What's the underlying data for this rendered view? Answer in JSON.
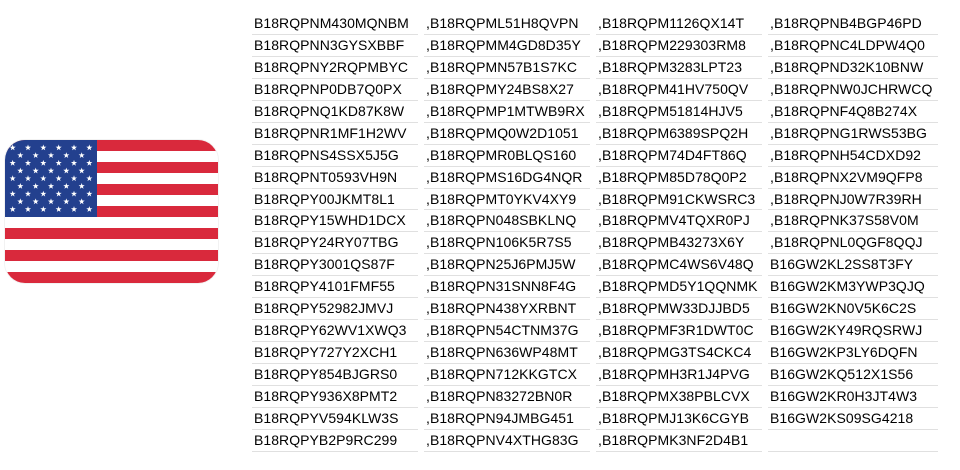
{
  "flag": {
    "name": "United States flag",
    "colors": {
      "red": "#d9293c",
      "white": "#ffffff",
      "blue": "#23408e",
      "stars": "#ffffff"
    }
  },
  "columns": [
    [
      "B18RQPNM430MQNBM",
      "B18RQPNN3GYSXBBF",
      "B18RQPNY2RQPMBYC",
      "B18RQPNP0DB7Q0PX",
      "B18RQPNQ1KD87K8W",
      "B18RQPNR1MF1H2WV",
      "B18RQPNS4SSX5J5G",
      "B18RQPNT0593VH9N",
      "B18RQPY00JKMT8L1",
      "B18RQPY15WHD1DCX",
      "B18RQPY24RY07TBG",
      "B18RQPY3001QS87F",
      "B18RQPY4101FMF55",
      "B18RQPY52982JMVJ",
      "B18RQPY62WV1XWQ3",
      "B18RQPY727Y2XCH1",
      "B18RQPY854BJGRS0",
      "B18RQPY936X8PMT2",
      "B18RQPYV594KLW3S",
      "B18RQPYB2P9RC299"
    ],
    [
      ",B18RQPML51H8QVPN",
      ",B18RQPMM4GD8D35Y",
      ",B18RQPMN57B1S7KC",
      ",B18RQPMY24BS8X27",
      ",B18RQPMP1MTWB9RX",
      ",B18RQPMQ0W2D1051",
      ",B18RQPMR0BLQS160",
      ",B18RQPMS16DG4NQR",
      ",B18RQPMT0YKV4XY9",
      ",B18RQPN048SBKLNQ",
      ",B18RQPN106K5R7S5",
      ",B18RQPN25J6PMJ5W",
      ",B18RQPN31SNN8F4G",
      ",B18RQPN438YXRBNT",
      ",B18RQPN54CTNM37G",
      ",B18RQPN636WP48MT",
      ",B18RQPN712KKGTCX",
      ",B18RQPN83272BN0R",
      ",B18RQPN94JMBG451",
      ",B18RQPNV4XTHG83G"
    ],
    [
      ",B18RQPM1126QX14T",
      ",B18RQPM229303RM8",
      ",B18RQPM3283LPT23",
      ",B18RQPM41HV750QV",
      ",B18RQPM51814HJV5",
      ",B18RQPM6389SPQ2H",
      ",B18RQPM74D4FT86Q",
      ",B18RQPM85D78Q0P2",
      ",B18RQPM91CKWSRC3",
      ",B18RQPMV4TQXR0PJ",
      ",B18RQPMB43273X6Y",
      ",B18RQPMC4WS6V48Q",
      ",B18RQPMD5Y1QQNMK",
      ",B18RQPMW33DJJBD5",
      ",B18RQPMF3R1DWT0C",
      ",B18RQPMG3TS4CKC4",
      ",B18RQPMH3R1J4PVG",
      ",B18RQPMX38PBLCVX",
      ",B18RQPMJ13K6CGYB",
      ",B18RQPMK3NF2D4B1"
    ],
    [
      ",B18RQPNB4BGP46PD",
      ",B18RQPNC4LDPW4Q0",
      ",B18RQPND32K10BNW",
      ",B18RQPNW0JCHRWCQ",
      ",B18RQPNF4Q8B274X",
      ",B18RQPNG1RWS53BG",
      ",B18RQPNH54CDXD92",
      ",B18RQPNX2VM9QFP8",
      ",B18RQPNJ0W7R39RH",
      ",B18RQPNK37S58V0M",
      ",B18RQPNL0QGF8QQJ",
      "B16GW2KL2SS8T3FY",
      "B16GW2KM3YWP3QJQ",
      "B16GW2KN0V5K6C2S",
      "B16GW2KY49RQSRWJ",
      "B16GW2KP3LY6DQFN",
      "B16GW2KQ512X1S56",
      "B16GW2KR0H3JT4W3",
      "B16GW2KS09SG4218"
    ]
  ]
}
